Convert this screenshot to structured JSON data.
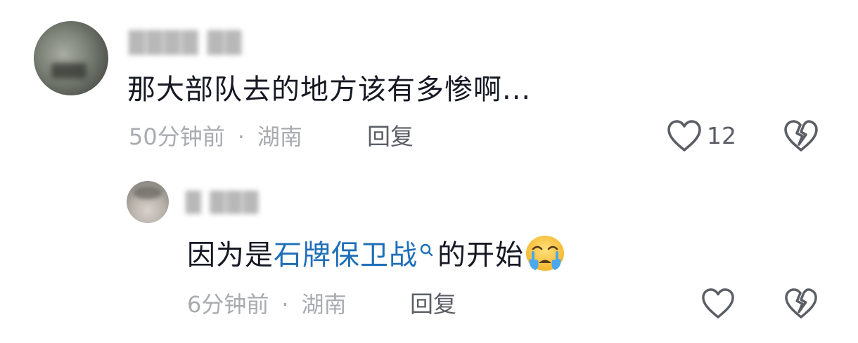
{
  "comments": [
    {
      "text": "那大部队去的地方该有多惨啊...",
      "time": "50分钟前",
      "separator": "·",
      "location": "湖南",
      "reply_label": "回复",
      "like_count": "12"
    },
    {
      "text_before": "因为是",
      "link_text": "石牌保卫战",
      "text_after": "的开始",
      "time": "6分钟前",
      "separator": "·",
      "location": "湖南",
      "reply_label": "回复"
    }
  ],
  "icons": {
    "like": "heart-outline-icon",
    "dislike": "broken-heart-icon",
    "search": "search-icon",
    "emoji": "crying-face-emoji"
  },
  "colors": {
    "text": "#161823",
    "meta": "#a9abb0",
    "link": "#1f6fb8",
    "icon": "#5c5e66"
  }
}
